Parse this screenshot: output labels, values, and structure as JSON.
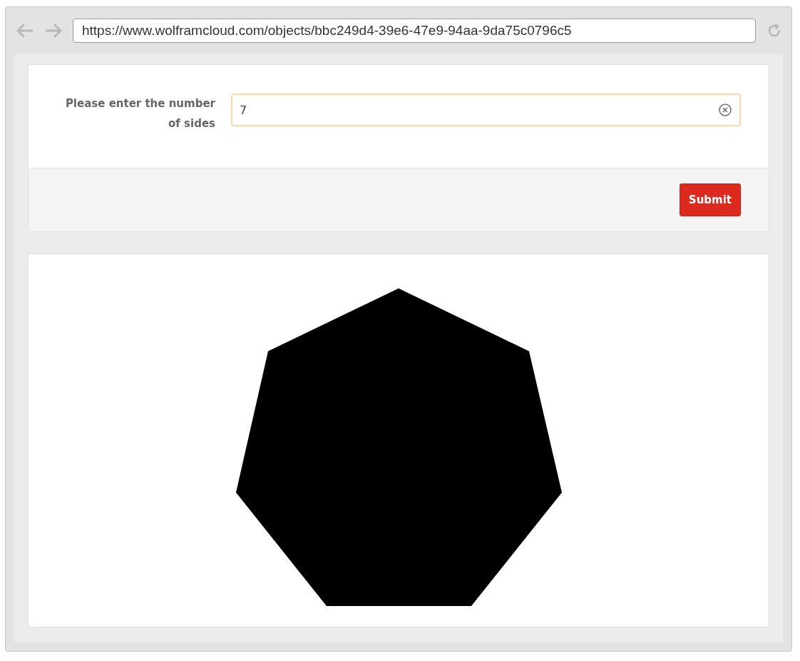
{
  "browser": {
    "url": "https://www.wolframcloud.com/objects/bbc249d4-39e6-47e9-94aa-9da75c0796c5"
  },
  "form": {
    "label": "Please enter the number of sides",
    "value": "7",
    "focused": true
  },
  "submit": {
    "label": "Submit"
  }
}
